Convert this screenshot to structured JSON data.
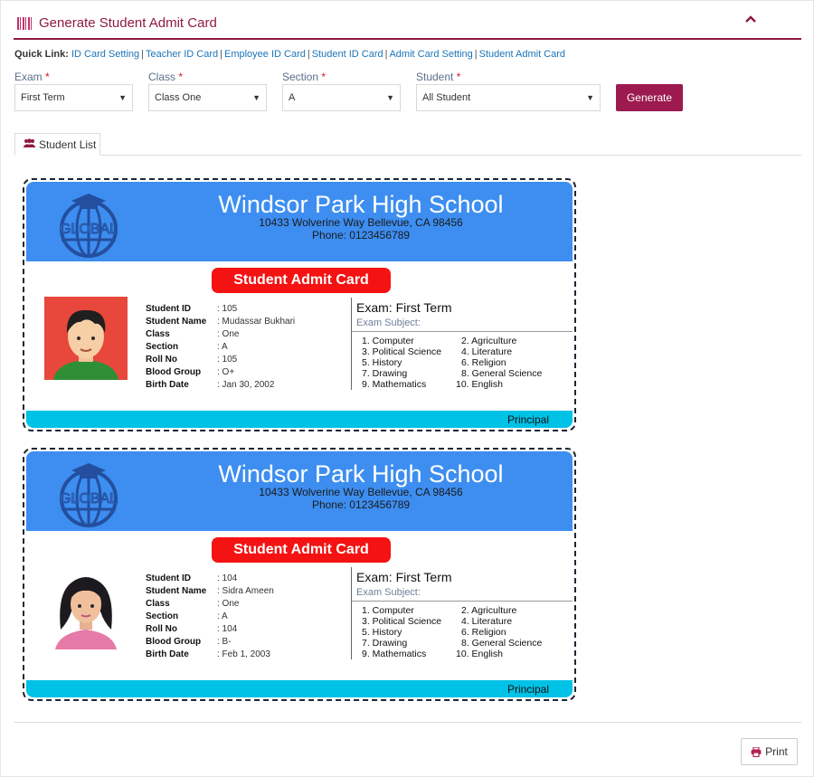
{
  "header": {
    "title": "Generate Student Admit Card"
  },
  "quick_links": {
    "label": "Quick Link:",
    "links": [
      "ID Card Setting",
      "Teacher ID Card",
      "Employee ID Card",
      "Student ID Card",
      "Admit Card Setting",
      "Student Admit Card"
    ]
  },
  "filters": {
    "exam": {
      "label": "Exam",
      "required": "*",
      "value": "First Term"
    },
    "class": {
      "label": "Class",
      "required": "*",
      "value": "Class One"
    },
    "section": {
      "label": "Section",
      "required": "*",
      "value": "A"
    },
    "student": {
      "label": "Student",
      "required": "*",
      "value": "All Student"
    },
    "generate_label": "Generate"
  },
  "tabs": {
    "student_list": "Student List"
  },
  "card_template": {
    "school_name": "Windsor Park High School",
    "address": "10433 Wolverine Way Bellevue, CA 98456",
    "phone": "Phone: 0123456789",
    "logo_text": "GLOBAL",
    "admit_title": "Student Admit Card",
    "exam_title": "Exam: First Term",
    "exam_subject_label": "Exam Subject:",
    "subjects": [
      "1. Computer",
      "2. Agriculture",
      "3. Political Science",
      "4. Literature",
      "5. History",
      "6. Religion",
      "7. Drawing",
      "8. General Science",
      "9. Mathematics",
      "10. English"
    ],
    "principal": "Principal",
    "field_labels": [
      "Student ID",
      "Student Name",
      "Class",
      "Section",
      "Roll No",
      "Blood Group",
      "Birth Date"
    ]
  },
  "cards": [
    {
      "student_id": ": 105",
      "student_name": ": Mudassar Bukhari",
      "class": ": One",
      "section": ": A",
      "roll_no": ": 105",
      "blood_group": ": O+",
      "birth_date": ": Jan 30, 2002",
      "avatar": "male-student-avatar"
    },
    {
      "student_id": ": 104",
      "student_name": ": Sidra Ameen",
      "class": ": One",
      "section": ": A",
      "roll_no": ": 104",
      "blood_group": ": B-",
      "birth_date": ": Feb 1, 2003",
      "avatar": "female-student-avatar"
    }
  ],
  "footer": {
    "print_label": "Print"
  },
  "colors": {
    "brand": "#8f1a45",
    "button": "#9c1a4f",
    "card_header": "#3d8ef0",
    "card_footer": "#00c1e6",
    "admit_badge": "#f51212",
    "link": "#1b74b8"
  }
}
